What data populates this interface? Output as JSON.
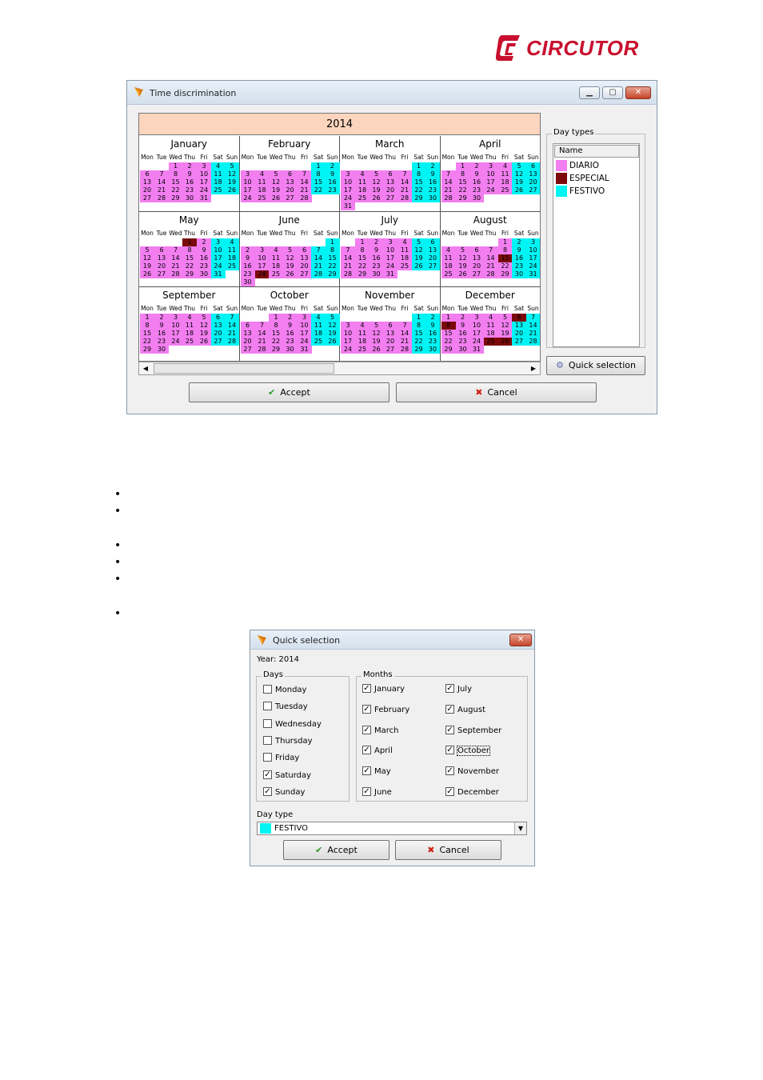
{
  "logo": {
    "brand": "CIRCUTOR"
  },
  "time_window": {
    "title": "Time discrimination",
    "year": "2014",
    "weekday_headers": [
      "Mon",
      "Tue",
      "Wed",
      "Thu",
      "Fri",
      "Sat",
      "Sun"
    ],
    "months": [
      {
        "name": "January",
        "start": 2,
        "days": 31,
        "especial": []
      },
      {
        "name": "February",
        "start": 5,
        "days": 28,
        "especial": []
      },
      {
        "name": "March",
        "start": 5,
        "days": 31,
        "especial": []
      },
      {
        "name": "April",
        "start": 1,
        "days": 30,
        "especial": []
      },
      {
        "name": "May",
        "start": 3,
        "days": 31,
        "especial": [
          1
        ]
      },
      {
        "name": "June",
        "start": 6,
        "days": 30,
        "especial": [
          24
        ]
      },
      {
        "name": "July",
        "start": 1,
        "days": 31,
        "especial": []
      },
      {
        "name": "August",
        "start": 4,
        "days": 31,
        "especial": [
          15
        ]
      },
      {
        "name": "September",
        "start": 0,
        "days": 30,
        "especial": []
      },
      {
        "name": "October",
        "start": 2,
        "days": 31,
        "especial": []
      },
      {
        "name": "November",
        "start": 5,
        "days": 30,
        "especial": []
      },
      {
        "name": "December",
        "start": 0,
        "days": 31,
        "especial": [
          6,
          8,
          25,
          26
        ]
      }
    ],
    "day_types_legend": "Day types",
    "day_types_header": "Name",
    "day_types": [
      {
        "name": "DIARIO",
        "color": "#f27ef0"
      },
      {
        "name": "ESPECIAL",
        "color": "#7c0a0a"
      },
      {
        "name": "FESTIVO",
        "color": "#00f4f4"
      }
    ],
    "quick_selection_label": "Quick selection",
    "accept_label": "Accept",
    "cancel_label": "Cancel"
  },
  "quick_window": {
    "title": "Quick selection",
    "year_label": "Year: 2014",
    "days_legend": "Days",
    "days": [
      {
        "label": "Monday",
        "checked": false
      },
      {
        "label": "Tuesday",
        "checked": false
      },
      {
        "label": "Wednesday",
        "checked": false
      },
      {
        "label": "Thursday",
        "checked": false
      },
      {
        "label": "Friday",
        "checked": false
      },
      {
        "label": "Saturday",
        "checked": true
      },
      {
        "label": "Sunday",
        "checked": true
      }
    ],
    "months_legend": "Months",
    "months": [
      {
        "label": "January",
        "checked": true
      },
      {
        "label": "February",
        "checked": true
      },
      {
        "label": "March",
        "checked": true
      },
      {
        "label": "April",
        "checked": true
      },
      {
        "label": "May",
        "checked": true
      },
      {
        "label": "June",
        "checked": true
      },
      {
        "label": "July",
        "checked": true
      },
      {
        "label": "August",
        "checked": true
      },
      {
        "label": "September",
        "checked": true
      },
      {
        "label": "October",
        "checked": true
      },
      {
        "label": "November",
        "checked": true
      },
      {
        "label": "December",
        "checked": true
      }
    ],
    "day_type_label": "Day type",
    "day_type_value": "FESTIVO",
    "day_type_color": "#00f4f4",
    "accept_label": "Accept",
    "cancel_label": "Cancel"
  },
  "bullets": [
    "•",
    "•",
    "•",
    "•",
    "•",
    "•"
  ]
}
